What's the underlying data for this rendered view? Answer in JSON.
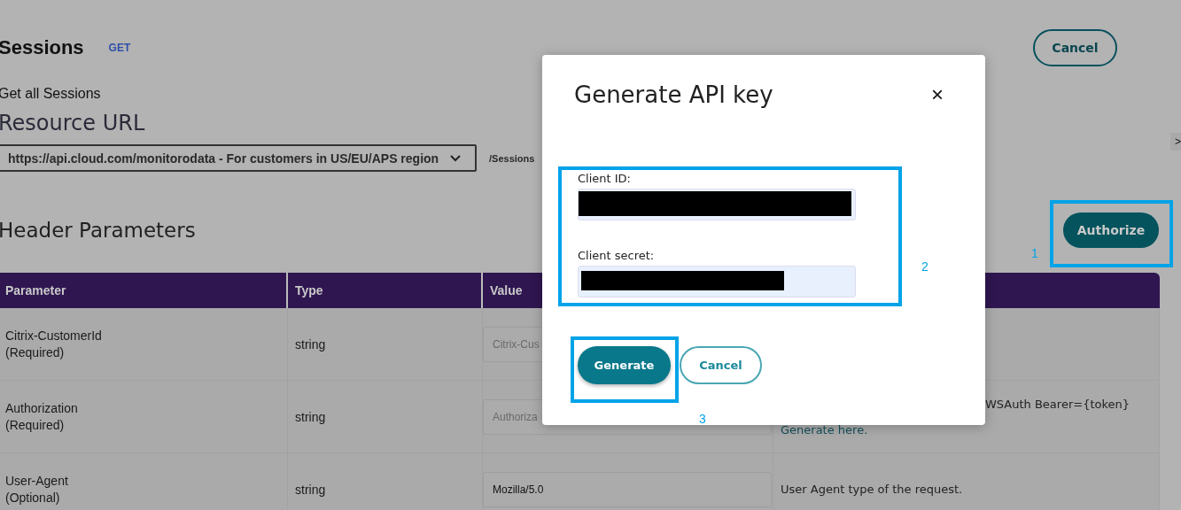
{
  "page": {
    "title": "Sessions",
    "method": "GET",
    "description": "Get all Sessions",
    "cancel_button": "Cancel"
  },
  "resource_url": {
    "heading": "Resource URL",
    "server": "https://api.cloud.com/monitorodata - For customers in US/EU/APS region",
    "path": "/Sessions",
    "side_toggle": ">"
  },
  "header_parameters": {
    "heading": "Header Parameters",
    "authorize_button": "Authorize",
    "columns": [
      "Parameter",
      "Type",
      "Value"
    ],
    "rows": [
      {
        "name": "Citrix-CustomerId",
        "requirement": "(Required)",
        "type": "string",
        "placeholder": "Citrix-Cus"
      },
      {
        "name": "Authorization",
        "requirement": "(Required)",
        "type": "string",
        "placeholder": "Authoriza",
        "description": "WSAuth Bearer={token}",
        "link": "Generate here."
      },
      {
        "name": "User-Agent",
        "requirement": "(Optional)",
        "type": "string",
        "value": "Mozilla/5.0",
        "description": "User Agent type of the request."
      }
    ]
  },
  "dialog": {
    "title": "Generate API key",
    "close": "×",
    "fields": [
      {
        "label": "Client ID:",
        "redacted": true
      },
      {
        "label": "Client secret:",
        "redacted": true
      }
    ],
    "buttons": [
      {
        "label": "Generate",
        "kind": "primary"
      },
      {
        "label": "Cancel",
        "kind": "secondary"
      }
    ]
  },
  "annotations": [
    {
      "label": "1"
    },
    {
      "label": "2"
    },
    {
      "label": "3"
    }
  ]
}
